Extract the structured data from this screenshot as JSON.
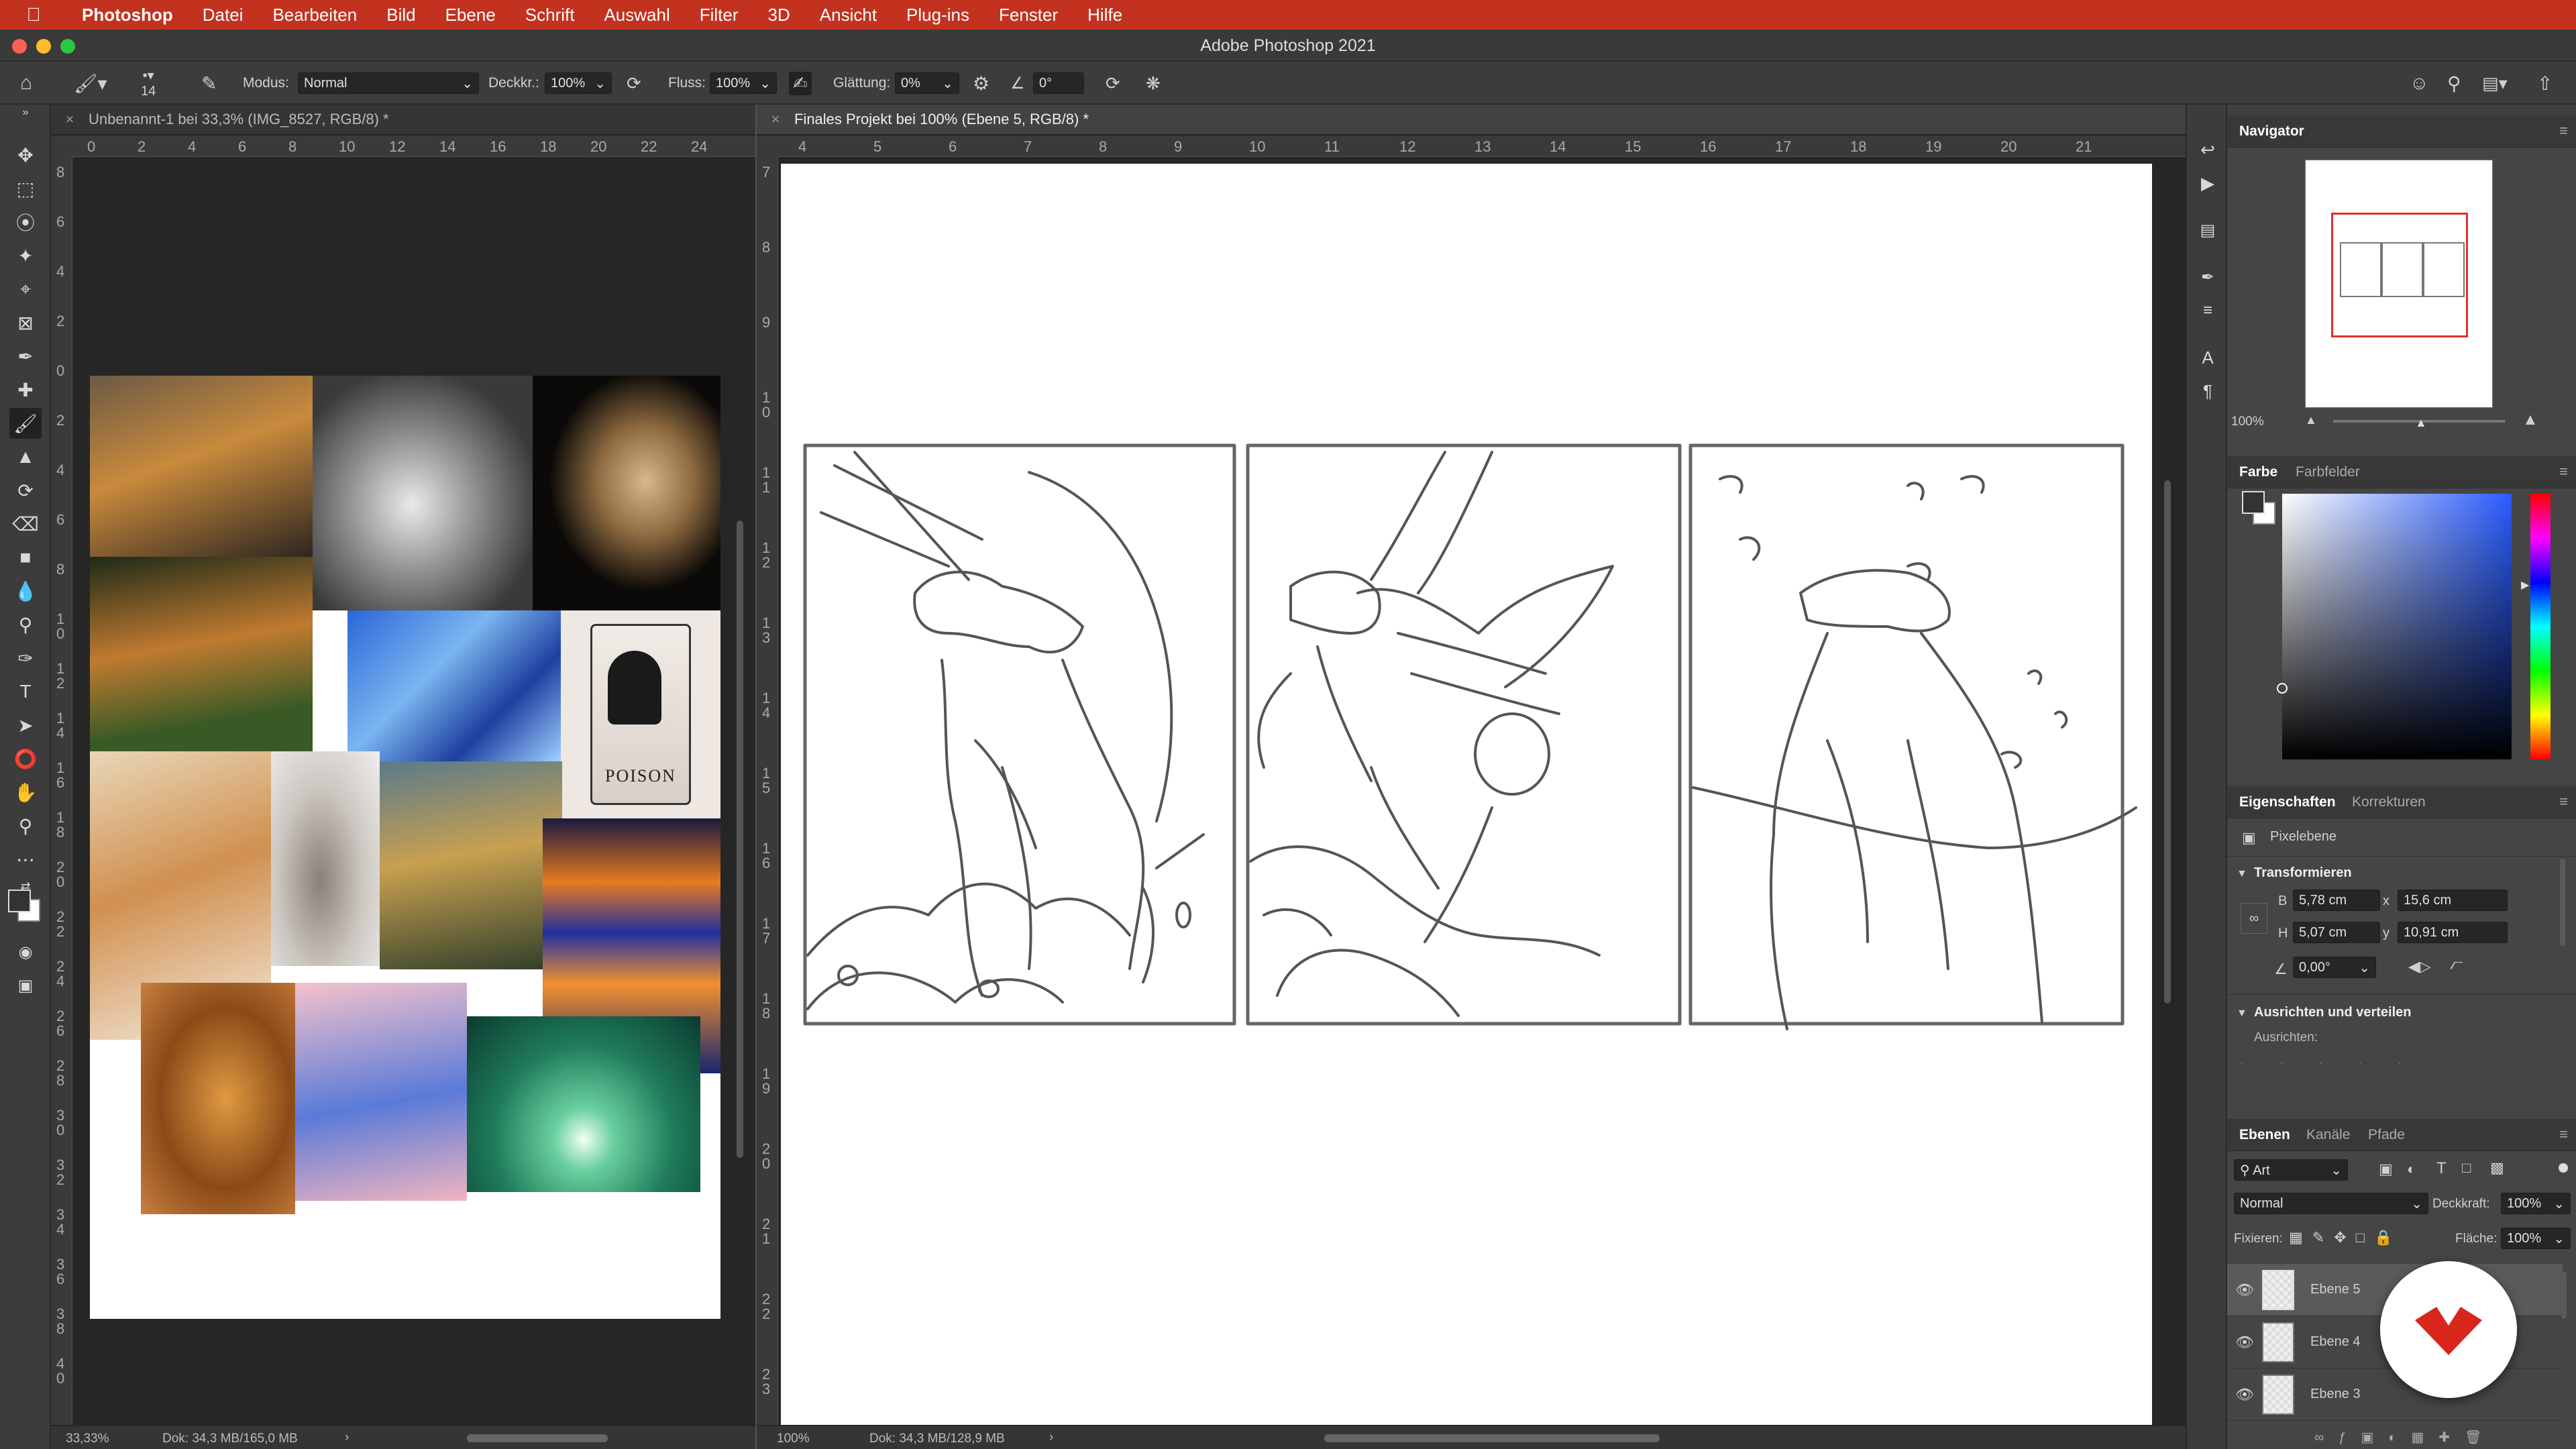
{
  "menubar": {
    "items": [
      "Photoshop",
      "Datei",
      "Bearbeiten",
      "Bild",
      "Ebene",
      "Schrift",
      "Auswahl",
      "Filter",
      "3D",
      "Ansicht",
      "Plug-ins",
      "Fenster",
      "Hilfe"
    ]
  },
  "window": {
    "title": "Adobe Photoshop 2021"
  },
  "options": {
    "brush_size": "14",
    "modus_label": "Modus:",
    "modus_value": "Normal",
    "deckkr_label": "Deckkr.:",
    "deckkr_value": "100%",
    "fluss_label": "Fluss:",
    "fluss_value": "100%",
    "glaettung_label": "Glättung:",
    "glaettung_value": "0%",
    "angle_value": "0°"
  },
  "doc_left": {
    "tab_title": "Unbenannt-1 bei 33,3% (IMG_8527, RGB/8) *",
    "ruler_h": [
      "0",
      "2",
      "4",
      "6",
      "8",
      "10",
      "12",
      "14",
      "16",
      "18",
      "20",
      "22",
      "24"
    ],
    "ruler_v": [
      "8",
      "6",
      "4",
      "2",
      "0",
      "2",
      "4",
      "6",
      "8",
      "1\n0",
      "1\n2",
      "1\n4",
      "1\n6",
      "1\n8",
      "2\n0",
      "2\n2",
      "2\n4",
      "2\n6",
      "2\n8",
      "3\n0",
      "3\n2",
      "3\n4",
      "3\n6",
      "3\n8",
      "4\n0"
    ],
    "moodboard_text": "POISON",
    "status_zoom": "33,33%",
    "status_doc": "Dok: 34,3 MB/165,0 MB"
  },
  "doc_right": {
    "tab_title": "Finales Projekt bei 100% (Ebene 5, RGB/8) *",
    "ruler_h": [
      "4",
      "5",
      "6",
      "7",
      "8",
      "9",
      "10",
      "11",
      "12",
      "13",
      "14",
      "15",
      "16",
      "17",
      "18",
      "19",
      "20",
      "21"
    ],
    "ruler_v": [
      "7",
      "8",
      "9",
      "1\n0",
      "1\n1",
      "1\n2",
      "1\n3",
      "1\n4",
      "1\n5",
      "1\n6",
      "1\n7",
      "1\n8",
      "1\n9",
      "2\n0",
      "2\n1",
      "2\n2",
      "2\n3"
    ],
    "status_zoom": "100%",
    "status_doc": "Dok: 34,3 MB/128,9 MB"
  },
  "navigator": {
    "tab": "Navigator",
    "zoom": "100%"
  },
  "color": {
    "tabs": [
      "Farbe",
      "Farbfelder"
    ],
    "foreground": "#333333",
    "background": "#ffffff"
  },
  "properties": {
    "tabs": [
      "Eigenschaften",
      "Korrekturen"
    ],
    "layer_type": "Pixelebene",
    "transform_header": "Transformieren",
    "b_label": "B",
    "b_value": "5,78 cm",
    "x_label": "x",
    "x_value": "15,6 cm",
    "h_label": "H",
    "h_value": "5,07 cm",
    "y_label": "y",
    "y_value": "10,91 cm",
    "angle_value": "0,00°",
    "align_header": "Ausrichten und verteilen",
    "align_label": "Ausrichten:"
  },
  "layers": {
    "tabs": [
      "Ebenen",
      "Kanäle",
      "Pfade"
    ],
    "filter_value": "Art",
    "blend_mode": "Normal",
    "opacity_label": "Deckkraft:",
    "opacity_value": "100%",
    "lock_label": "Fixieren:",
    "fill_label": "Fläche:",
    "fill_value": "100%",
    "items": [
      {
        "name": "Ebene 5",
        "selected": true
      },
      {
        "name": "Ebene 4",
        "selected": false
      },
      {
        "name": "Ebene 3",
        "selected": false
      }
    ]
  },
  "colors": {
    "menubar": "#c2321f",
    "accent_logo": "#d9261c",
    "nav_frame": "#e03030"
  }
}
